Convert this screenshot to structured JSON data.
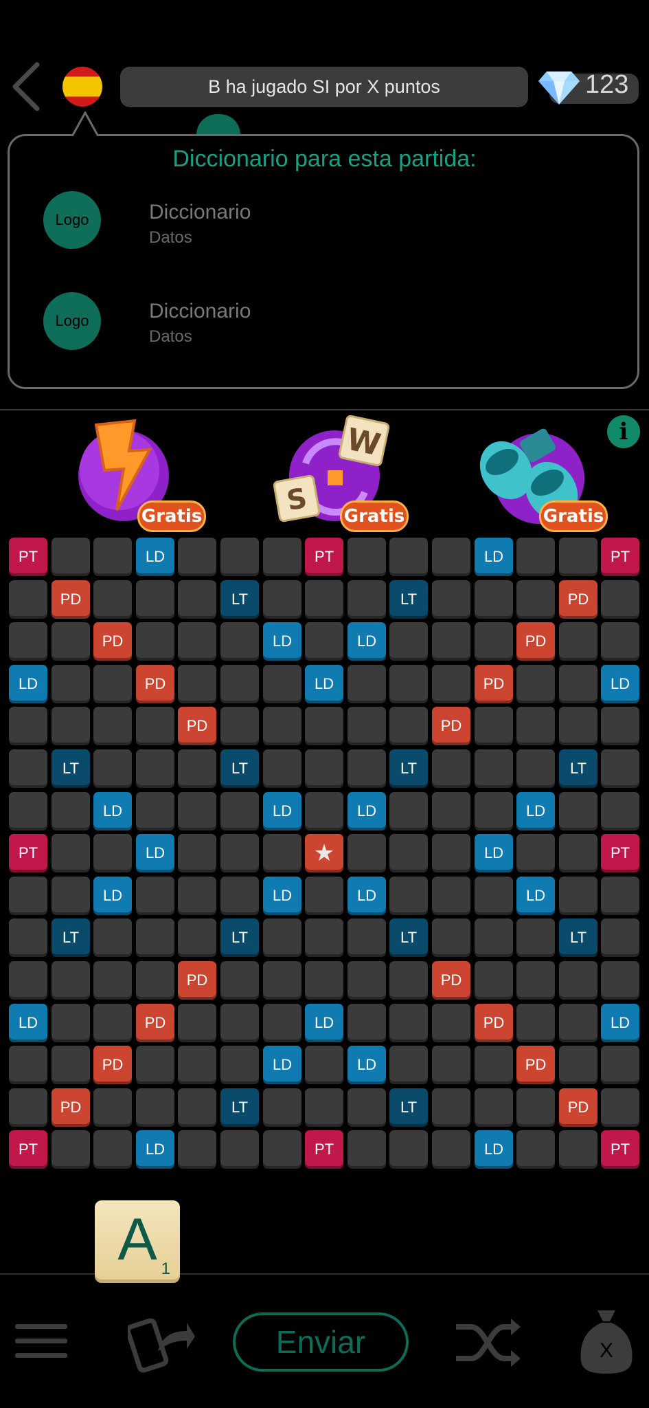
{
  "header": {
    "status_message": "B ha jugado SI por X puntos",
    "gems": "123",
    "colors": {
      "accent": "#17a083",
      "status_bg": "#3c3c3c"
    }
  },
  "popup": {
    "title": "Diccionario para esta partida:",
    "items": [
      {
        "logo": "Logo",
        "name": "Diccionario",
        "sub": "Datos"
      },
      {
        "logo": "Logo",
        "name": "Diccionario",
        "sub": "Datos"
      }
    ]
  },
  "powerups": [
    {
      "icon": "lightning-icon",
      "label": "Gratis"
    },
    {
      "icon": "swap-letters-icon",
      "label": "Gratis"
    },
    {
      "icon": "binoculars-icon",
      "label": "Gratis"
    }
  ],
  "board": {
    "size": 15,
    "colors": {
      "PT": "#c0184a",
      "PD": "#cc4530",
      "LD": "#0f7bb0",
      "LT": "#0a4a6a",
      "empty": "#3b3b3b",
      "star": "#cc4530"
    },
    "rows": [
      [
        "PT",
        "",
        "",
        "LD",
        "",
        "",
        "",
        "PT",
        "",
        "",
        "",
        "LD",
        "",
        "",
        "PT"
      ],
      [
        "",
        "PD",
        "",
        "",
        "",
        "LT",
        "",
        "",
        "",
        "LT",
        "",
        "",
        "",
        "PD",
        ""
      ],
      [
        "",
        "",
        "PD",
        "",
        "",
        "",
        "LD",
        "",
        "LD",
        "",
        "",
        "",
        "PD",
        "",
        ""
      ],
      [
        "LD",
        "",
        "",
        "PD",
        "",
        "",
        "",
        "LD",
        "",
        "",
        "",
        "PD",
        "",
        "",
        "LD"
      ],
      [
        "",
        "",
        "",
        "",
        "PD",
        "",
        "",
        "",
        "",
        "",
        "PD",
        "",
        "",
        "",
        ""
      ],
      [
        "",
        "LT",
        "",
        "",
        "",
        "LT",
        "",
        "",
        "",
        "LT",
        "",
        "",
        "",
        "LT",
        ""
      ],
      [
        "",
        "",
        "LD",
        "",
        "",
        "",
        "LD",
        "",
        "LD",
        "",
        "",
        "",
        "LD",
        "",
        ""
      ],
      [
        "PT",
        "",
        "",
        "LD",
        "",
        "",
        "",
        "★",
        "",
        "",
        "",
        "LD",
        "",
        "",
        "PT"
      ],
      [
        "",
        "",
        "LD",
        "",
        "",
        "",
        "LD",
        "",
        "LD",
        "",
        "",
        "",
        "LD",
        "",
        ""
      ],
      [
        "",
        "LT",
        "",
        "",
        "",
        "LT",
        "",
        "",
        "",
        "LT",
        "",
        "",
        "",
        "LT",
        ""
      ],
      [
        "",
        "",
        "",
        "",
        "PD",
        "",
        "",
        "",
        "",
        "",
        "PD",
        "",
        "",
        "",
        ""
      ],
      [
        "LD",
        "",
        "",
        "PD",
        "",
        "",
        "",
        "LD",
        "",
        "",
        "",
        "PD",
        "",
        "",
        "LD"
      ],
      [
        "",
        "",
        "PD",
        "",
        "",
        "",
        "LD",
        "",
        "LD",
        "",
        "",
        "",
        "PD",
        "",
        ""
      ],
      [
        "",
        "PD",
        "",
        "",
        "",
        "LT",
        "",
        "",
        "",
        "LT",
        "",
        "",
        "",
        "PD",
        ""
      ],
      [
        "PT",
        "",
        "",
        "LD",
        "",
        "",
        "",
        "PT",
        "",
        "",
        "",
        "LD",
        "",
        "",
        "PT"
      ]
    ]
  },
  "rack": {
    "letter": "A",
    "score": "1"
  },
  "bottom": {
    "send_label": "Enviar",
    "bag_label": "X"
  }
}
